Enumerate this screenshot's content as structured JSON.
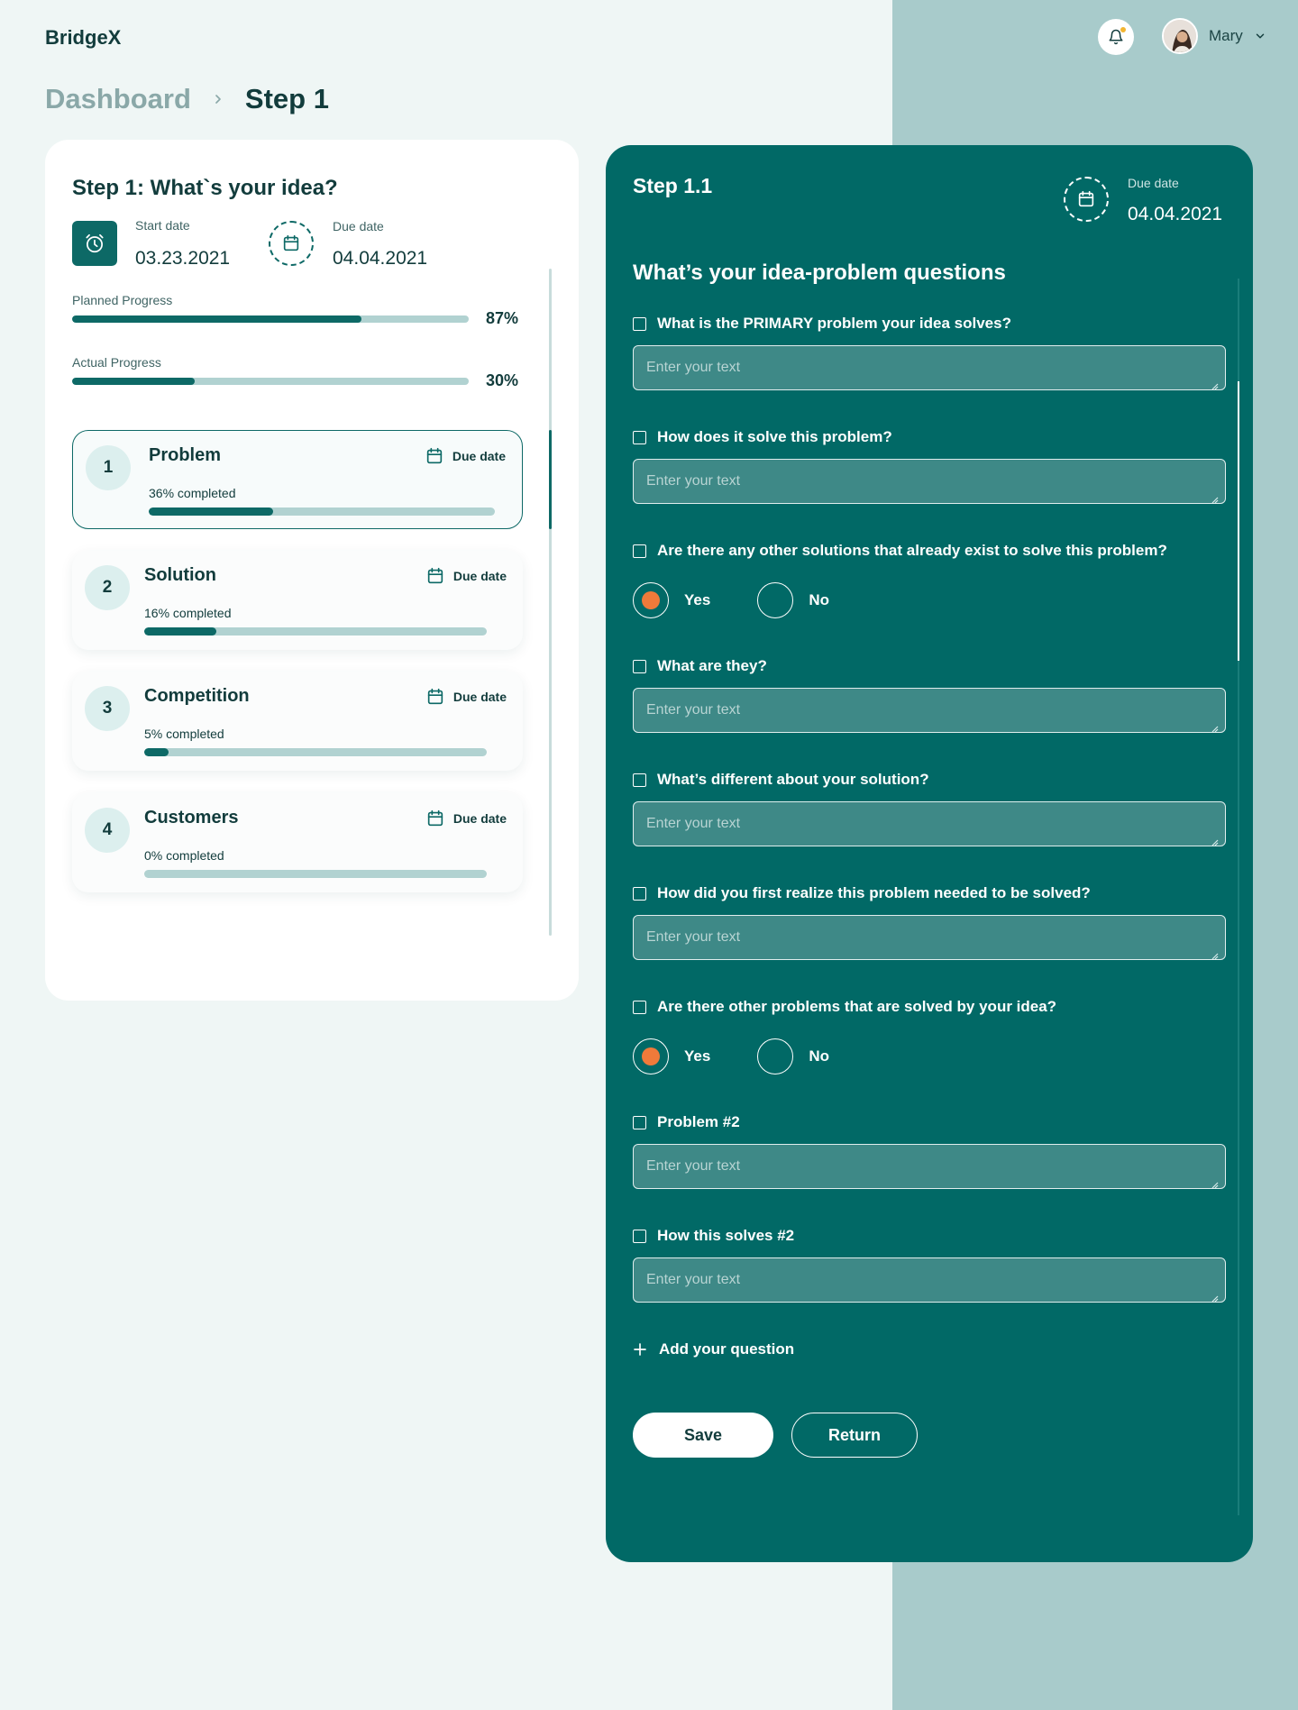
{
  "app": {
    "brand": "BridgeX"
  },
  "user": {
    "name": "Mary"
  },
  "breadcrumb": {
    "items": [
      "Dashboard",
      "Step 1"
    ]
  },
  "left": {
    "title": "Step 1: What`s your idea?",
    "start_label": "Start date",
    "start_value": "03.23.2021",
    "due_label": "Due date",
    "due_value": "04.04.2021",
    "planned": {
      "label": "Planned  Progress",
      "pct": "87%",
      "fraction": 0.73
    },
    "actual": {
      "label": "Actual Progress",
      "pct": "30%",
      "fraction": 0.31
    },
    "steps": [
      {
        "num": "1",
        "name": "Problem",
        "completed": "36% completed",
        "fraction": 0.36,
        "due": "Due date"
      },
      {
        "num": "2",
        "name": "Solution",
        "completed": "16% completed",
        "fraction": 0.21,
        "due": "Due date"
      },
      {
        "num": "3",
        "name": "Competition",
        "completed": "5% completed",
        "fraction": 0.07,
        "due": "Due date"
      },
      {
        "num": "4",
        "name": "Customers",
        "completed": "0% completed",
        "fraction": 0,
        "due": "Due date"
      }
    ]
  },
  "right": {
    "title": "Step 1.1",
    "due_label": "Due date",
    "due_value": "04.04.2021",
    "section_title": "What’s your idea-problem questions",
    "placeholder": "Enter your text",
    "questions": [
      "What is the PRIMARY problem your idea solves?",
      "How does it solve this problem?",
      "Are there any other solutions that already exist to solve this problem?",
      "What are they?",
      "What’s different about your solution?",
      "How did you first realize this problem needed to be solved?",
      "Are there other problems that are solved by your idea?",
      "Problem #2",
      "How this solves #2"
    ],
    "yes_label": "Yes",
    "no_label": "No",
    "add_question": "Add your question",
    "save": "Save",
    "return": "Return"
  },
  "colors": {
    "primary": "#016966",
    "accent": "#ef7a3a",
    "background": "#eff6f5",
    "side_band": "#a8cbcb"
  },
  "icons": [
    "bell-icon",
    "chevron-down-icon",
    "chevron-right-icon",
    "clock-icon",
    "calendar-icon",
    "plus-icon"
  ]
}
